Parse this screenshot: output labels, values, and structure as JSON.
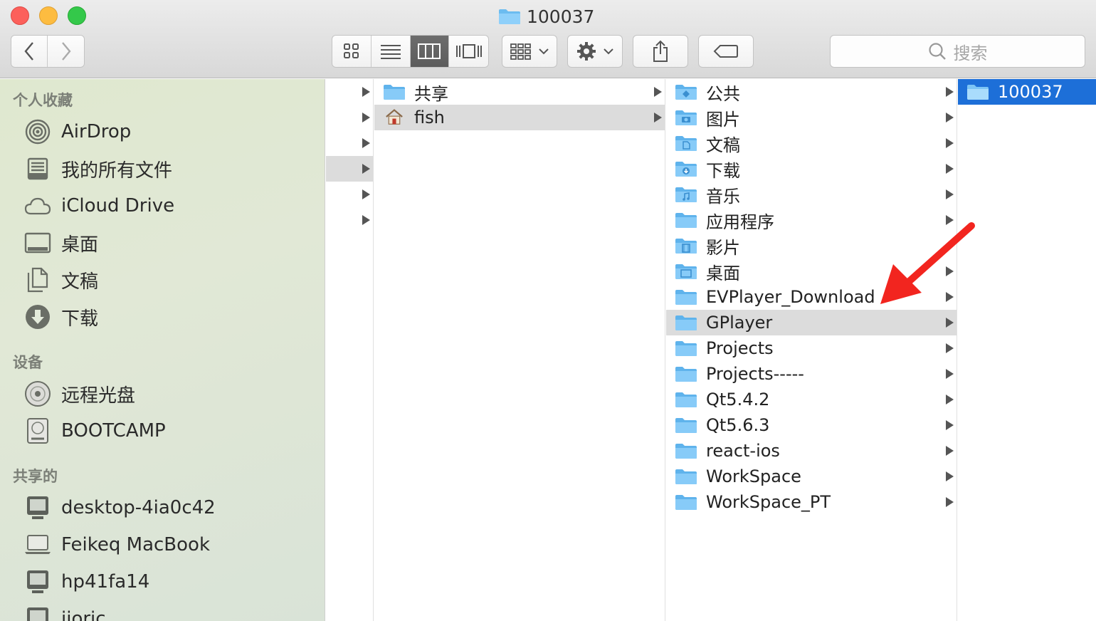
{
  "window": {
    "title": "100037"
  },
  "toolbar": {
    "view_buttons": [
      "icon-view",
      "list-view",
      "column-view",
      "cover-flow-view"
    ],
    "search_placeholder": "搜索"
  },
  "sidebar": {
    "favorites_header": "个人收藏",
    "favorites": [
      {
        "label": "AirDrop",
        "icon": "airdrop-icon"
      },
      {
        "label": "我的所有文件",
        "icon": "all-files-icon"
      },
      {
        "label": "iCloud Drive",
        "icon": "cloud-icon"
      },
      {
        "label": "桌面",
        "icon": "desktop-icon"
      },
      {
        "label": "文稿",
        "icon": "documents-icon"
      },
      {
        "label": "下载",
        "icon": "download-icon"
      }
    ],
    "devices_header": "设备",
    "devices": [
      {
        "label": "远程光盘",
        "icon": "disc-icon"
      },
      {
        "label": "BOOTCAMP",
        "icon": "hard-drive-icon"
      }
    ],
    "shared_header": "共享的",
    "shared": [
      {
        "label": "desktop-4ia0c42",
        "icon": "pc-icon"
      },
      {
        "label": "Feikeq MacBook",
        "icon": "laptop-icon"
      },
      {
        "label": "hp41fa14",
        "icon": "pc-icon"
      },
      {
        "label": "jioric",
        "icon": "pc-icon"
      }
    ]
  },
  "columns": {
    "col2": [
      {
        "label": "共享",
        "icon": "folder"
      },
      {
        "label": "fish",
        "icon": "home-icon",
        "selected": true
      }
    ],
    "col3": [
      {
        "label": "公共",
        "icon": "public-folder"
      },
      {
        "label": "图片",
        "icon": "pictures-folder"
      },
      {
        "label": "文稿",
        "icon": "documents-folder"
      },
      {
        "label": "下载",
        "icon": "downloads-folder"
      },
      {
        "label": "音乐",
        "icon": "music-folder"
      },
      {
        "label": "应用程序",
        "icon": "folder"
      },
      {
        "label": "影片",
        "icon": "movies-folder"
      },
      {
        "label": "桌面",
        "icon": "desktop-folder"
      },
      {
        "label": "EVPlayer_Download",
        "icon": "folder"
      },
      {
        "label": "GPlayer",
        "icon": "folder",
        "selected": true
      },
      {
        "label": "Projects",
        "icon": "folder"
      },
      {
        "label": "Projects-----",
        "icon": "folder"
      },
      {
        "label": "Qt5.4.2",
        "icon": "folder"
      },
      {
        "label": "Qt5.6.3",
        "icon": "folder"
      },
      {
        "label": "react-ios",
        "icon": "folder"
      },
      {
        "label": "WorkSpace",
        "icon": "folder"
      },
      {
        "label": "WorkSpace_PT",
        "icon": "folder"
      }
    ],
    "col4": [
      {
        "label": "100037",
        "icon": "folder",
        "selected": true
      }
    ]
  },
  "annotation": {
    "color": "#f2251f",
    "icon": "red-arrow"
  }
}
